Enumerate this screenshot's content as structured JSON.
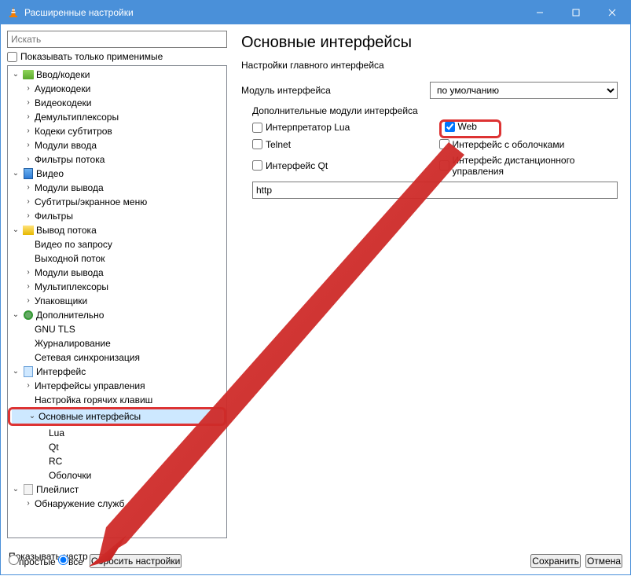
{
  "titlebar": {
    "title": "Расширенные настройки"
  },
  "left": {
    "search_placeholder": "Искать",
    "show_only_label": "Показывать только применимые",
    "tree": {
      "input_codecs": "Ввод/кодеки",
      "audio_codecs": "Аудиокодеки",
      "video_codecs": "Видеокодеки",
      "demux": "Демультиплексоры",
      "sub_codecs": "Кодеки субтитров",
      "input_modules": "Модули ввода",
      "stream_filters": "Фильтры потока",
      "video": "Видео",
      "output_modules": "Модули вывода",
      "osd": "Субтитры/экранное меню",
      "filters": "Фильтры",
      "stream_out": "Вывод потока",
      "vod": "Видео по запросу",
      "out_stream": "Выходной поток",
      "out_modules": "Модули вывода",
      "muxers": "Мультиплексоры",
      "packagers": "Упаковщики",
      "advanced": "Дополнительно",
      "gnutls": "GNU TLS",
      "logging": "Журналирование",
      "netsync": "Сетевая синхронизация",
      "interface": "Интерфейс",
      "ctrl_interfaces": "Интерфейсы управления",
      "hotkeys": "Настройка горячих клавиш",
      "main_interfaces": "Основные интерфейсы",
      "lua": "Lua",
      "qt": "Qt",
      "rc": "RC",
      "skins": "Оболочки",
      "playlist": "Плейлист",
      "sd": "Обнаружение служб"
    }
  },
  "right": {
    "heading": "Основные интерфейсы",
    "subheading": "Настройки главного интерфейса",
    "module_label": "Модуль интерфейса",
    "module_value": "по умолчанию",
    "extra_label": "Дополнительные модули интерфейса",
    "chk_lua": "Интерпретатор Lua",
    "chk_web": "Web",
    "chk_telnet": "Telnet",
    "chk_skins": "Интерфейс с оболочками",
    "chk_qt": "Интерфейс Qt",
    "chk_rc": "Интерфейс дистанционного управления",
    "modules_value": "http"
  },
  "footer": {
    "show_label": "Показывать настр",
    "radio_simple": "простые",
    "radio_all": "все",
    "reset": "Сбросить настройки",
    "save": "Сохранить",
    "cancel": "Отмена"
  }
}
